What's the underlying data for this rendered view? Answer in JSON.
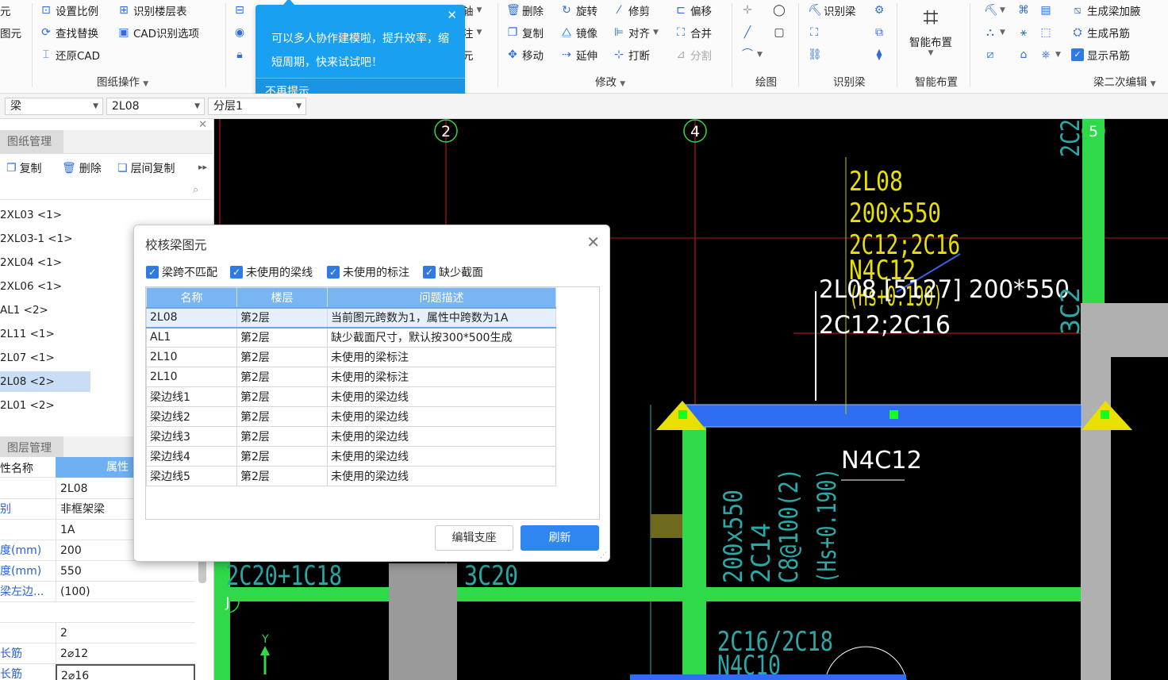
{
  "ribbon": {
    "col1": [
      "元",
      "图元"
    ],
    "drawing": {
      "items": [
        "设置比例",
        "识别楼层表",
        "查找替换",
        "CAD识别选项",
        "还原CAD"
      ],
      "group": "图纸操作"
    },
    "axis_partial": [
      "轴",
      "注",
      "元"
    ],
    "modify": {
      "items": [
        "删除",
        "旋转",
        "修剪",
        "偏移",
        "复制",
        "镜像",
        "对齐",
        "合并",
        "移动",
        "延伸",
        "打断",
        "分割"
      ],
      "group": "修改"
    },
    "draw_group": "绘图",
    "recognize": {
      "item": "识别梁",
      "group": "识别梁"
    },
    "smart": {
      "label": "智能布置",
      "group": "智能布置"
    },
    "secondary": {
      "items": [
        "生成梁加腋",
        "生成吊筋",
        "显示吊筋"
      ],
      "group": "梁二次编辑"
    }
  },
  "tooltip": {
    "text": "可以多人协作建模啦，提升效率，缩短周期，快来试试吧！",
    "dismiss": "不再提示"
  },
  "selectors": {
    "type": "梁",
    "element": "2L08",
    "layer": "分层1"
  },
  "drawing_panel": {
    "title": "图纸管理",
    "toolbar": [
      "复制",
      "删除",
      "层间复制"
    ],
    "items": [
      "2XL03 <1>",
      "2XL03-1 <1>",
      "2XL04 <1>",
      "2XL06 <1>",
      "AL1 <2>",
      "2L11 <1>",
      "2L07 <1>",
      "2L08 <2>",
      "2L01 <2>"
    ],
    "selected_index": 7
  },
  "layer_panel": {
    "title": "图层管理",
    "header_key": "性名称",
    "header_val": "属性",
    "rows": [
      {
        "k": "",
        "v": "2L08"
      },
      {
        "k": "别",
        "v": "非框架梁"
      },
      {
        "k": "",
        "v": "1A"
      },
      {
        "k": "度(mm)",
        "v": "200"
      },
      {
        "k": "度(mm)",
        "v": "550"
      },
      {
        "k": "梁左边...",
        "v": "(100)"
      },
      {
        "k": "",
        "v": ""
      },
      {
        "k": "",
        "v": "2"
      },
      {
        "k": "长筋",
        "v": "2⌀12"
      },
      {
        "k": "长筋",
        "v": "2⌀16"
      }
    ]
  },
  "cad": {
    "axis_labels": [
      "2",
      "4",
      "5",
      "J"
    ],
    "annotation_main": [
      "2L08 [5127] 200*550",
      "2C12;2C16"
    ],
    "annotation_stack": [
      "2L08",
      "200x550",
      "2C12;2C16",
      "N4C12",
      "(Hs+0.190)"
    ],
    "n4": "N4C12",
    "vertical_text": [
      "200x550",
      "2C14",
      "C8@100(2)",
      "(Hs+0.190)"
    ],
    "bottom_texts": [
      "2C20+1C18",
      "3C20",
      "2C16/2C18",
      "N4C10"
    ],
    "right_texts": [
      "2C2",
      "3C2"
    ]
  },
  "dialog": {
    "title": "校核梁图元",
    "filters": [
      "梁跨不匹配",
      "未使用的梁线",
      "未使用的标注",
      "缺少截面"
    ],
    "columns": [
      "名称",
      "楼层",
      "问题描述"
    ],
    "rows": [
      {
        "name": "2L08",
        "floor": "第2层",
        "desc": "当前图元跨数为1，属性中跨数为1A"
      },
      {
        "name": "AL1",
        "floor": "第2层",
        "desc": "缺少截面尺寸，默认按300*500生成"
      },
      {
        "name": "2L10",
        "floor": "第2层",
        "desc": "未使用的梁标注"
      },
      {
        "name": "2L10",
        "floor": "第2层",
        "desc": "未使用的梁标注"
      },
      {
        "name": "梁边线1",
        "floor": "第2层",
        "desc": "未使用的梁边线"
      },
      {
        "name": "梁边线2",
        "floor": "第2层",
        "desc": "未使用的梁边线"
      },
      {
        "name": "梁边线3",
        "floor": "第2层",
        "desc": "未使用的梁边线"
      },
      {
        "name": "梁边线4",
        "floor": "第2层",
        "desc": "未使用的梁边线"
      },
      {
        "name": "梁边线5",
        "floor": "第2层",
        "desc": "未使用的梁边线"
      }
    ],
    "selected_row": 0,
    "buttons": {
      "edit_support": "编辑支座",
      "refresh": "刷新"
    }
  },
  "colors": {
    "canvas_bg": "#000000",
    "beam_green": "#2fd94a",
    "beam_blue": "#2e6cf0",
    "cad_yellow": "#e8e000",
    "cad_cyan": "#2aa9a9",
    "axis_red": "#d41e1e",
    "dialog_header": "#79b4f3",
    "primary_button": "#2f86f0",
    "tooltip_bg": "#1aa0f0"
  }
}
